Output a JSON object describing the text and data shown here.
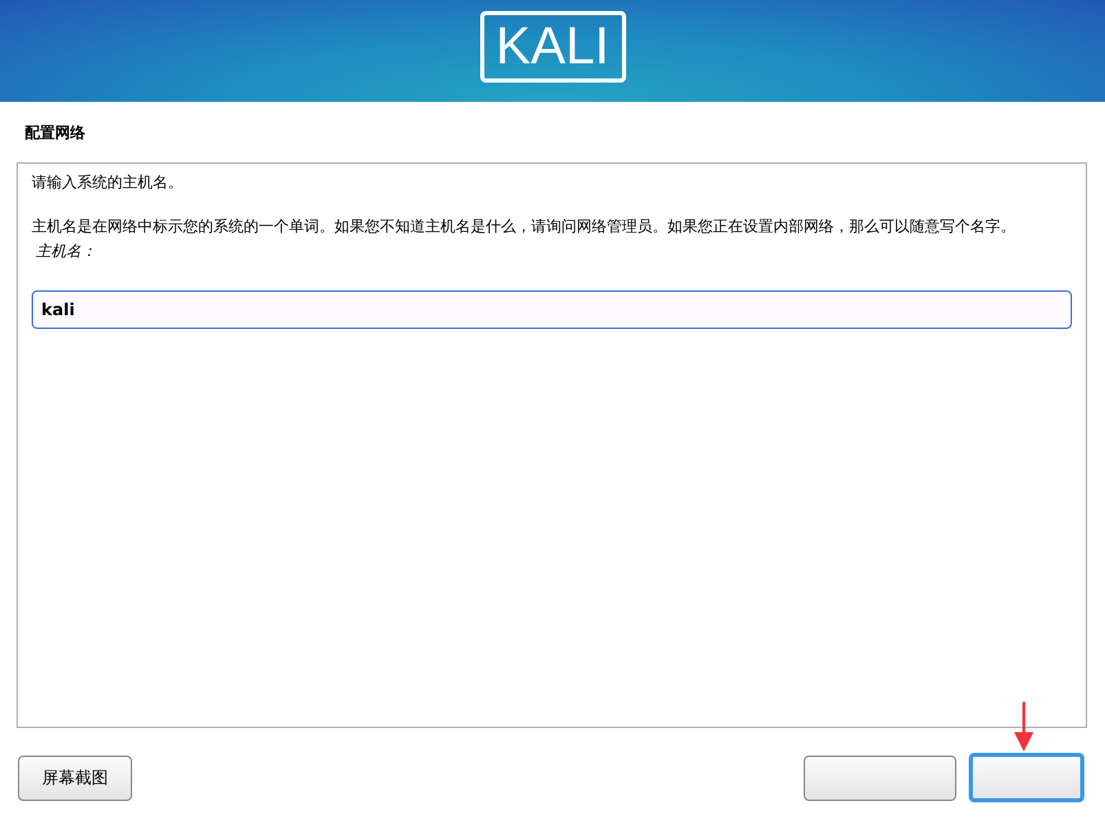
{
  "header": {
    "logo": "KALI"
  },
  "section_title": "配置网络",
  "panel": {
    "prompt": "请输入系统的主机名。",
    "description": "主机名是在网络中标示您的系统的一个单词。如果您不知道主机名是什么，请询问网络管理员。如果您正在设置内部网络，那么可以随意写个名字。",
    "field_label": "主机名：",
    "field_value": "kali"
  },
  "buttons": [
    {
      "kind": "screenshot",
      "label": "屏幕截图",
      "selected": false
    },
    {
      "kind": "back",
      "selected": false
    },
    {
      "kind": "continue",
      "selected": true
    }
  ]
}
